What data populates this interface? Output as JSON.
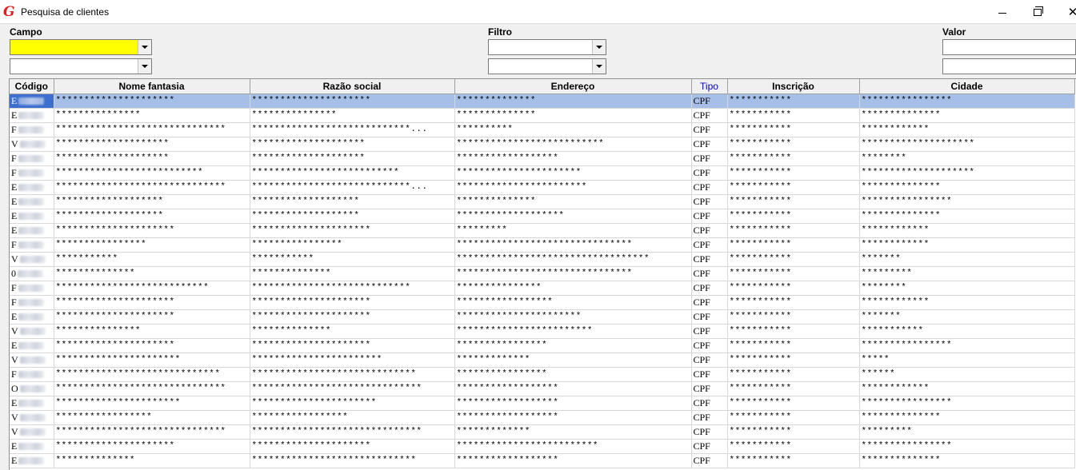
{
  "window": {
    "title": "Pesquisa de clientes",
    "logo_glyph": "G"
  },
  "filters": {
    "campo_label": "Campo",
    "filtro_label": "Filtro",
    "valor_label": "Valor",
    "campo_value_1": "",
    "campo_value_2": "",
    "filtro_value_1": "",
    "filtro_value_2": "",
    "valor_value_1": "",
    "valor_value_2": "",
    "highlight_color": "#ffff00"
  },
  "table": {
    "columns": [
      "Código",
      "Nome fantasia",
      "Razão social",
      "Endereço",
      "Tipo",
      "Inscrição",
      "Cidade"
    ],
    "selection_color": "#a6bfe8",
    "rows": [
      [
        "E",
        "*********************",
        "*********************",
        "**************",
        "CPF",
        "***********",
        "****************"
      ],
      [
        "E",
        "***************",
        "***************",
        "**************",
        "CPF",
        "***********",
        "**************"
      ],
      [
        "F",
        "******************************",
        "****************************...",
        "**********",
        "CPF",
        "***********",
        "************"
      ],
      [
        "V",
        "********************",
        "********************",
        "**************************",
        "CPF",
        "***********",
        "********************"
      ],
      [
        "F",
        "********************",
        "********************",
        "******************",
        "CPF",
        "***********",
        "********"
      ],
      [
        "F",
        "**************************",
        "**************************",
        "**********************",
        "CPF",
        "***********",
        "********************"
      ],
      [
        "E",
        "******************************",
        "****************************...",
        "***********************",
        "CPF",
        "***********",
        "**************"
      ],
      [
        "E",
        "*******************",
        "*******************",
        "**************",
        "CPF",
        "***********",
        "****************"
      ],
      [
        "E",
        "*******************",
        "*******************",
        "*******************",
        "CPF",
        "***********",
        "**************"
      ],
      [
        "E",
        "*********************",
        "*********************",
        "*********",
        "CPF",
        "***********",
        "************"
      ],
      [
        "F",
        "****************",
        "****************",
        "*******************************",
        "CPF",
        "***********",
        "************"
      ],
      [
        "V",
        "***********",
        "***********",
        "**********************************",
        "CPF",
        "***********",
        "*******"
      ],
      [
        "0",
        "**************",
        "**************",
        "*******************************",
        "CPF",
        "***********",
        "*********"
      ],
      [
        "F",
        "***************************",
        "****************************",
        "***************",
        "CPF",
        "***********",
        "********"
      ],
      [
        "F",
        "*********************",
        "*********************",
        "*****************",
        "CPF",
        "***********",
        "************"
      ],
      [
        "E",
        "*********************",
        "*********************",
        "**********************",
        "CPF",
        "***********",
        "*******"
      ],
      [
        "V",
        "***************",
        "**************",
        "************************",
        "CPF",
        "***********",
        "***********"
      ],
      [
        "E",
        "*********************",
        "*********************",
        "****************",
        "CPF",
        "***********",
        "****************"
      ],
      [
        "V",
        "**********************",
        "***********************",
        "*************",
        "CPF",
        "***********",
        "*****"
      ],
      [
        "F",
        "*****************************",
        "*****************************",
        "****************",
        "CPF",
        "***********",
        "******"
      ],
      [
        "O",
        "******************************",
        "******************************",
        "******************",
        "CPF",
        "***********",
        "************"
      ],
      [
        "E",
        "**********************",
        "**********************",
        "******************",
        "CPF",
        "***********",
        "****************"
      ],
      [
        "V",
        "*****************",
        "*****************",
        "******************",
        "CPF",
        "***********",
        "**************"
      ],
      [
        "V",
        "******************************",
        "******************************",
        "*************",
        "CPF",
        "***********",
        "*********"
      ],
      [
        "E",
        "*********************",
        "*********************",
        "*************************",
        "CPF",
        "***********",
        "****************"
      ],
      [
        "E",
        "**************",
        "*****************************",
        "******************",
        "CPF",
        "***********",
        "**************"
      ]
    ]
  }
}
